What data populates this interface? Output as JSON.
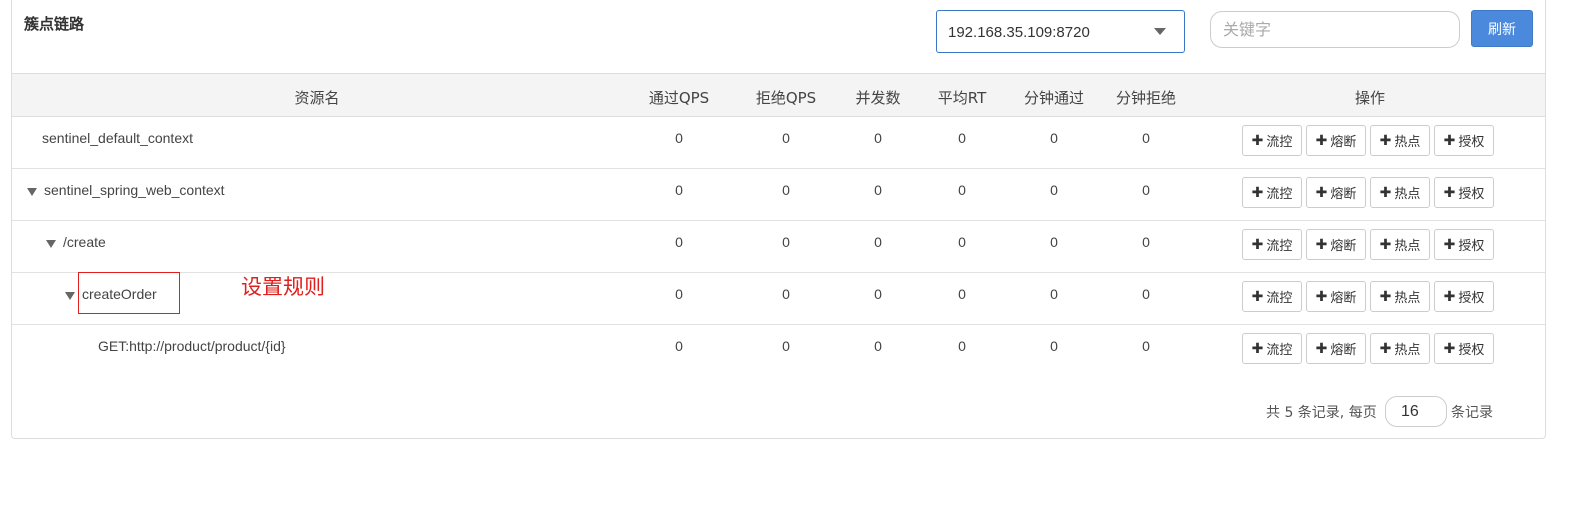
{
  "panel": {
    "title": "簇点链路"
  },
  "toolbar": {
    "machine": "192.168.35.109:8720",
    "search_placeholder": "关键字",
    "refresh_label": "刷新"
  },
  "table": {
    "headers": [
      "资源名",
      "通过QPS",
      "拒绝QPS",
      "并发数",
      "平均RT",
      "分钟通过",
      "分钟拒绝",
      "操作"
    ],
    "rows": [
      {
        "name": "sentinel_default_context",
        "expandable": false,
        "values": [
          "0",
          "0",
          "0",
          "0",
          "0",
          "0"
        ]
      },
      {
        "name": "sentinel_spring_web_context",
        "expandable": true,
        "values": [
          "0",
          "0",
          "0",
          "0",
          "0",
          "0"
        ]
      },
      {
        "name": "/create",
        "expandable": true,
        "values": [
          "0",
          "0",
          "0",
          "0",
          "0",
          "0"
        ]
      },
      {
        "name": "createOrder",
        "expandable": true,
        "values": [
          "0",
          "0",
          "0",
          "0",
          "0",
          "0"
        ]
      },
      {
        "name": "GET:http://product/product/{id}",
        "expandable": false,
        "values": [
          "0",
          "0",
          "0",
          "0",
          "0",
          "0"
        ]
      }
    ],
    "actions": [
      "流控",
      "熔断",
      "热点",
      "授权"
    ]
  },
  "annotation": {
    "text": "设置规则",
    "color": "#e0201e"
  },
  "pager": {
    "summary": "共 5 条记录, 每页",
    "page_size": "16",
    "suffix": "条记录"
  },
  "colors": {
    "primary": "#4a89dc",
    "header_bg": "#f4f4f4",
    "annotation": "#e0201e"
  }
}
